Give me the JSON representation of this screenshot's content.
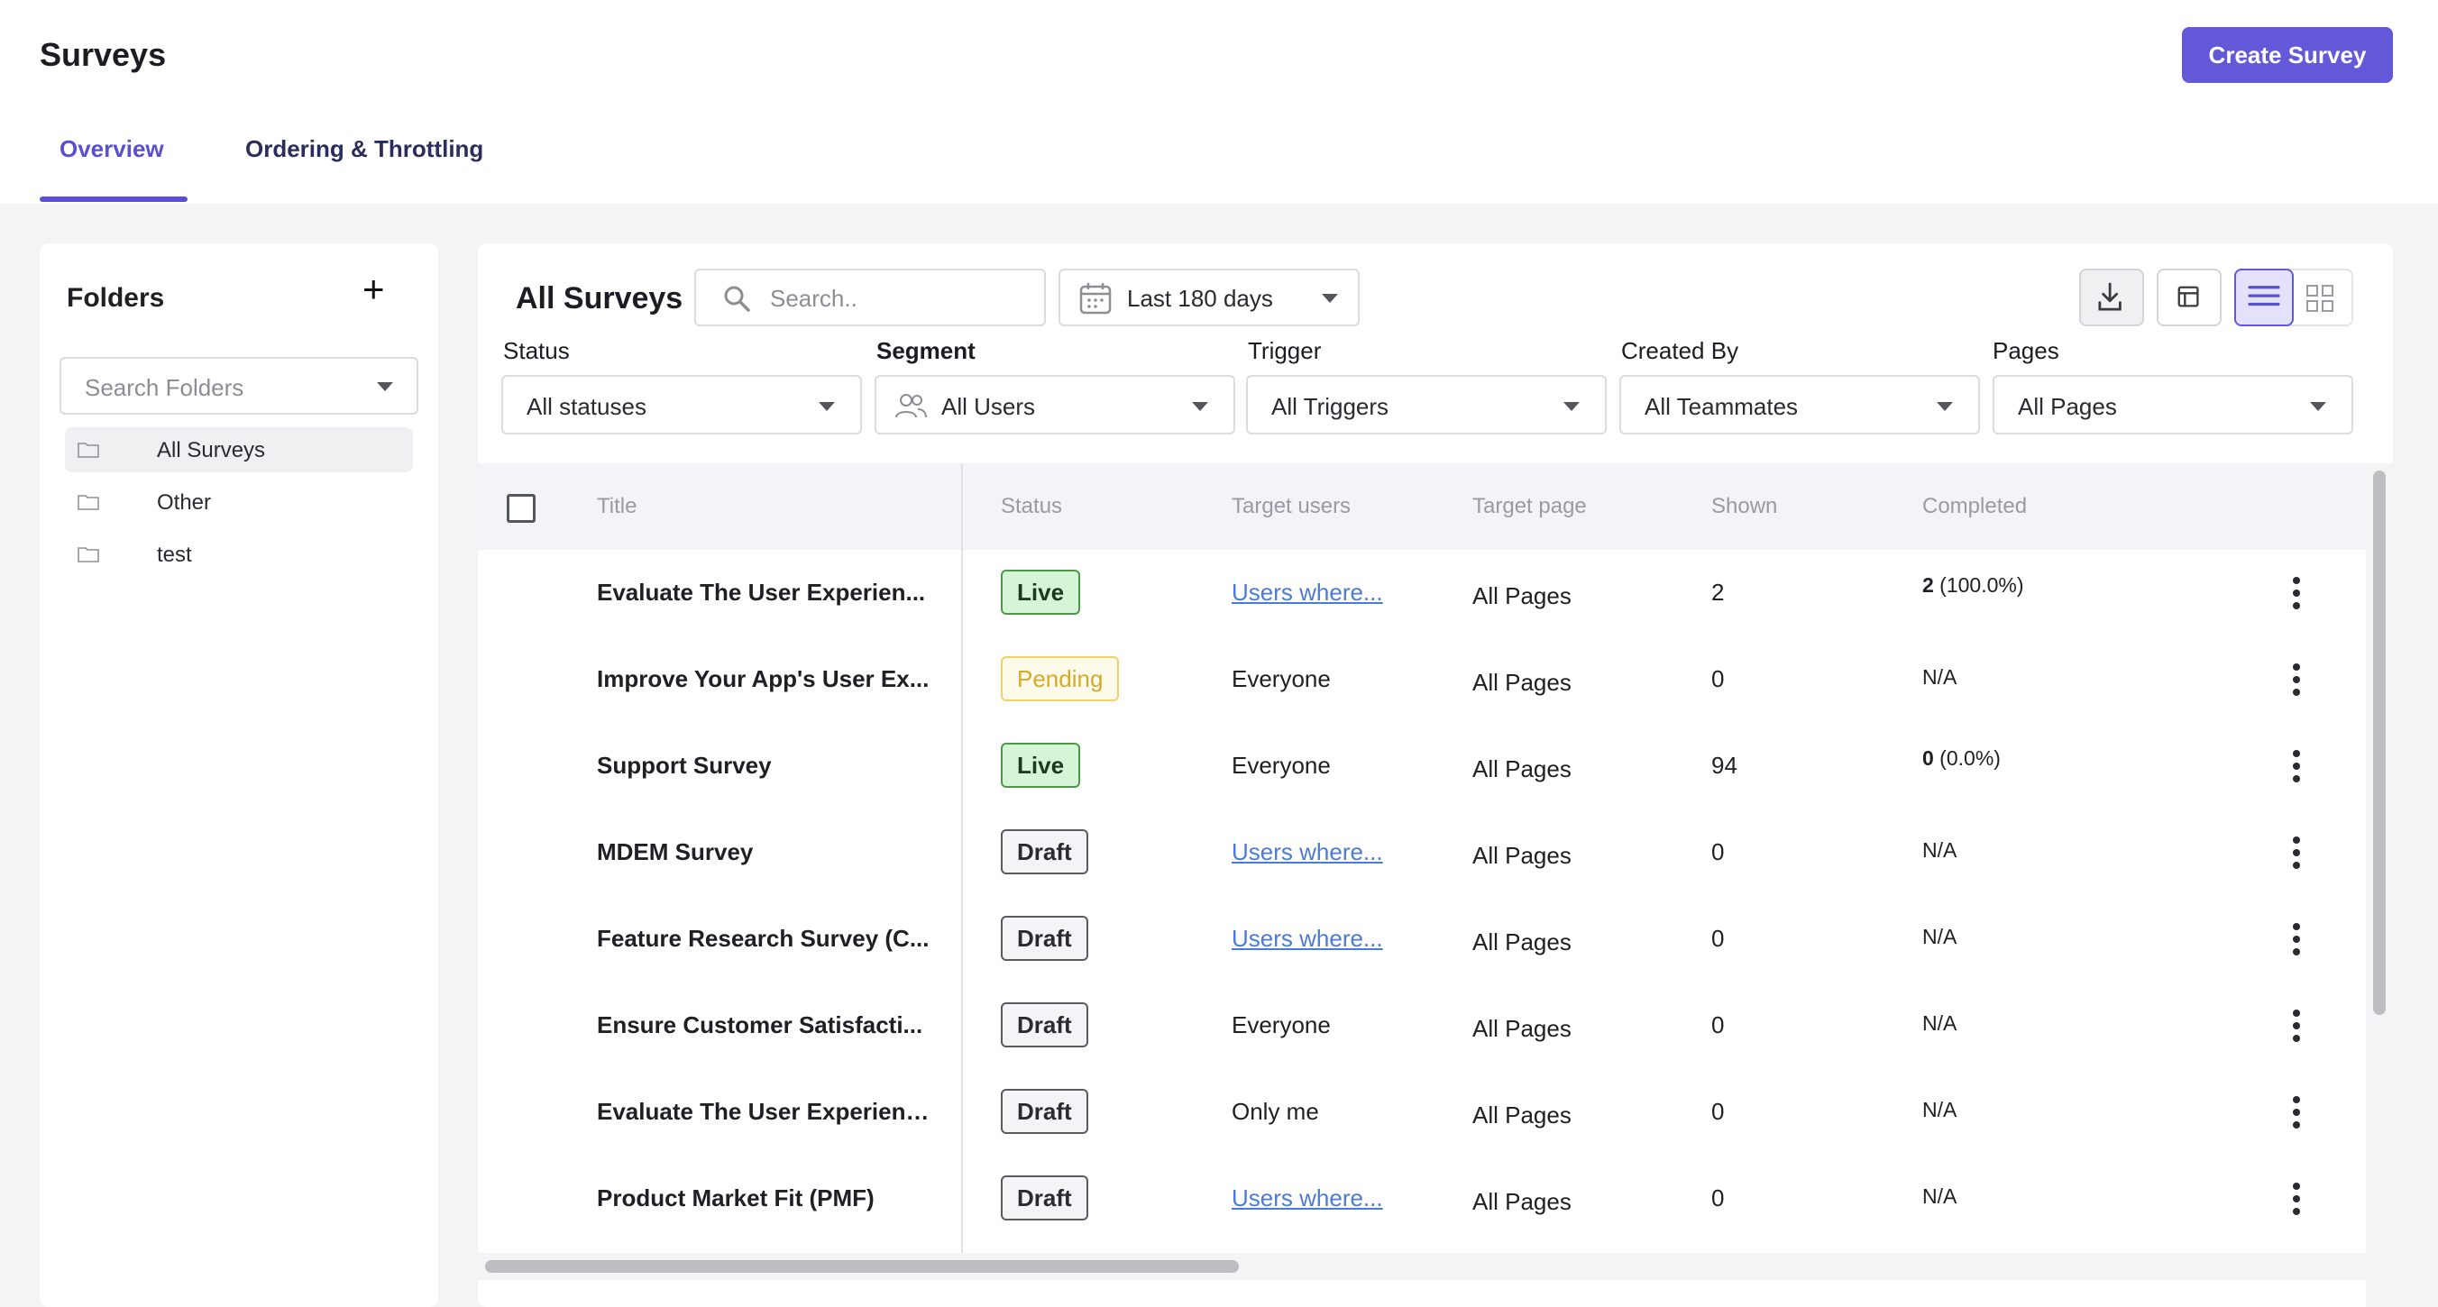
{
  "header": {
    "title": "Surveys",
    "create_button": "Create Survey",
    "tabs": [
      "Overview",
      "Ordering & Throttling"
    ]
  },
  "folders": {
    "title": "Folders",
    "add_symbol": "+",
    "search_placeholder": "Search Folders",
    "items": [
      {
        "label": "All Surveys",
        "active": true
      },
      {
        "label": "Other",
        "active": false
      },
      {
        "label": "test",
        "active": false
      }
    ]
  },
  "main": {
    "title": "All Surveys",
    "search_placeholder": "Search..",
    "date_range": "Last 180 days",
    "filters": {
      "status": {
        "label": "Status",
        "value": "All statuses"
      },
      "segment": {
        "label": "Segment",
        "value": "All Users"
      },
      "trigger": {
        "label": "Trigger",
        "value": "All Triggers"
      },
      "created_by": {
        "label": "Created By",
        "value": "All Teammates"
      },
      "pages": {
        "label": "Pages",
        "value": "All Pages"
      }
    }
  },
  "table": {
    "columns": [
      "Title",
      "Status",
      "Target users",
      "Target page",
      "Shown",
      "Completed"
    ],
    "rows": [
      {
        "title": "Evaluate The User Experien...",
        "status": "Live",
        "target_users": "Users where...",
        "target_page": "All Pages",
        "shown": "2",
        "completed_count": "2",
        "completed_pct": " (100.0%)"
      },
      {
        "title": "Improve Your App's User Ex...",
        "status": "Pending",
        "target_users": "Everyone",
        "target_page": "All Pages",
        "shown": "0",
        "completed_na": "N/A"
      },
      {
        "title": "Support Survey",
        "status": "Live",
        "target_users": "Everyone",
        "target_page": "All Pages",
        "shown": "94",
        "completed_count": "0",
        "completed_pct": " (0.0%)"
      },
      {
        "title": "MDEM Survey",
        "status": "Draft",
        "target_users": "Users where...",
        "target_page": "All Pages",
        "shown": "0",
        "completed_na": "N/A"
      },
      {
        "title": "Feature Research Survey (C...",
        "status": "Draft",
        "target_users": "Users where...",
        "target_page": "All Pages",
        "shown": "0",
        "completed_na": "N/A"
      },
      {
        "title": "Ensure Customer Satisfacti...",
        "status": "Draft",
        "target_users": "Everyone",
        "target_page": "All Pages",
        "shown": "0",
        "completed_na": "N/A"
      },
      {
        "title": "Evaluate The User Experience",
        "status": "Draft",
        "target_users": "Only me",
        "target_page": "All Pages",
        "shown": "0",
        "completed_na": "N/A"
      },
      {
        "title": "Product Market Fit (PMF)",
        "status": "Draft",
        "target_users": "Users where...",
        "target_page": "All Pages",
        "shown": "0",
        "completed_na": "N/A"
      }
    ]
  },
  "colors": {
    "accent": "#6358d8",
    "live_bg": "#d6f5d6",
    "pending_text": "#d8a82a",
    "link": "#4a7bd6"
  }
}
